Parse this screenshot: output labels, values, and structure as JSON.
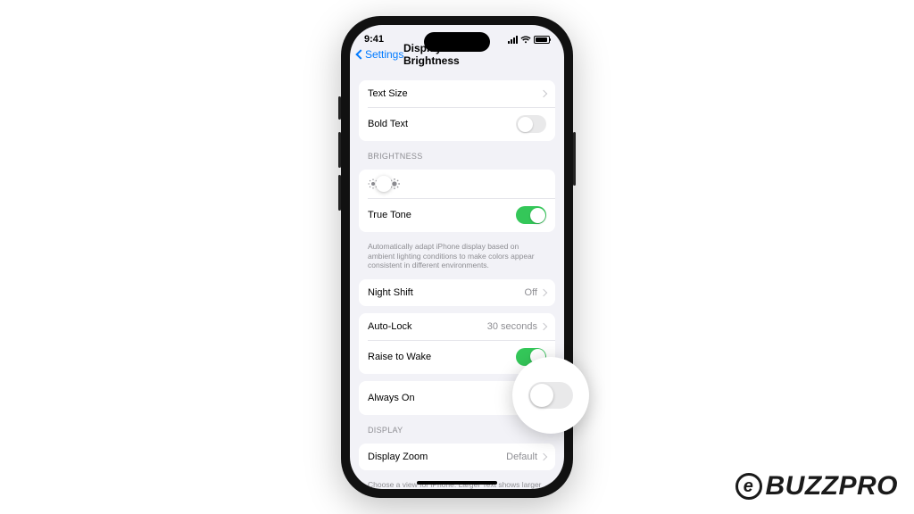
{
  "status": {
    "time": "9:41"
  },
  "nav": {
    "back": "Settings",
    "title": "Display & Brightness"
  },
  "rows": {
    "text_size": "Text Size",
    "bold_text": "Bold Text",
    "true_tone": "True Tone",
    "night_shift": "Night Shift",
    "night_shift_value": "Off",
    "auto_lock": "Auto-Lock",
    "auto_lock_value": "30 seconds",
    "raise_to_wake": "Raise to Wake",
    "always_on": "Always On",
    "display_zoom": "Display Zoom",
    "display_zoom_value": "Default"
  },
  "headers": {
    "brightness": "Brightness",
    "display": "Display"
  },
  "footers": {
    "true_tone": "Automatically adapt iPhone display based on ambient lighting conditions to make colors appear consistent in different environments.",
    "display_zoom": "Choose a view for iPhone. Larger Text shows larger controls. Default shows more content."
  },
  "slider": {
    "percent": 45
  },
  "toggles": {
    "bold_text": false,
    "true_tone": true,
    "raise_to_wake": true,
    "always_on": false
  },
  "watermark": {
    "text": "BUZZPRO",
    "badge": "e"
  }
}
